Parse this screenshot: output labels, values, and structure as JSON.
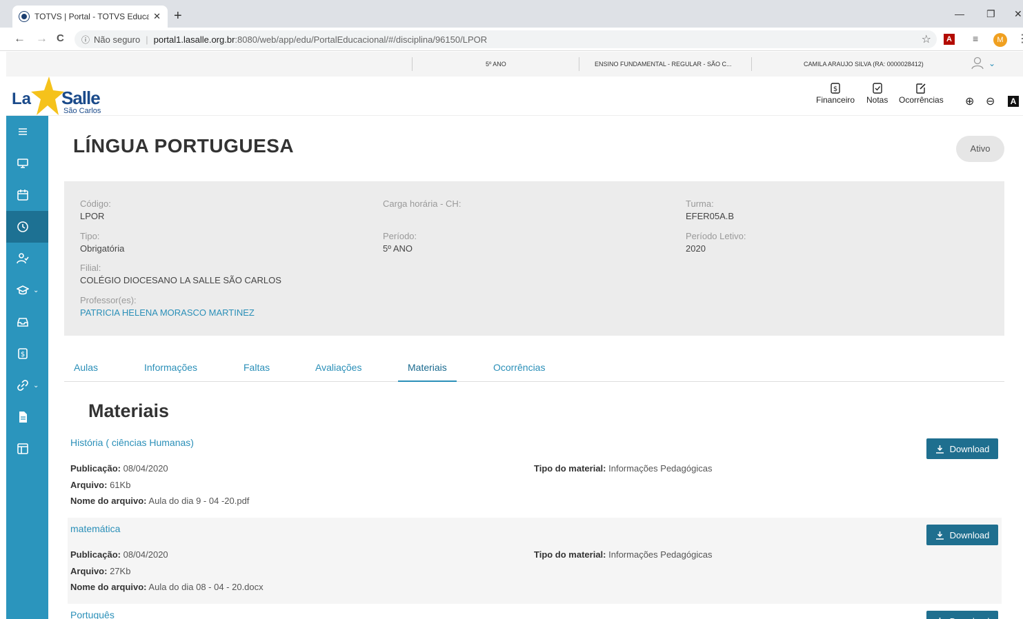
{
  "browser": {
    "tab_title": "TOTVS | Portal - TOTVS Educacio",
    "tab_close": "✕",
    "new_tab": "+",
    "minimize": "—",
    "maximize": "❐",
    "close": "✕",
    "back": "←",
    "forward": "→",
    "reload": "C",
    "info_icon": "ⓘ",
    "security_label": "Não seguro",
    "url_host": "portal1.lasalle.org.br",
    "url_path": ":8080/web/app/edu/PortalEducacional/#/disciplina/96150/LPOR",
    "star": "☆",
    "pdf_ext": "A",
    "list_ext": "≡",
    "profile_initial": "M",
    "kebab": "⋮"
  },
  "context_bar": {
    "grade": "5º ANO",
    "course": "ENSINO FUNDAMENTAL - REGULAR - SÃO C...",
    "student": "CAMILA ARAUJO SILVA (RA: 0000028412)",
    "chevron": "⌄"
  },
  "logo": {
    "la": "La",
    "salle": "Salle",
    "subtitle": "São Carlos"
  },
  "quick_access": [
    {
      "label": "Financeiro",
      "icon": "dollar-doc-icon"
    },
    {
      "label": "Notas",
      "icon": "check-doc-icon"
    },
    {
      "label": "Ocorrências",
      "icon": "edit-doc-icon"
    }
  ],
  "accessibility": {
    "zoom_in": "⊕",
    "zoom_out": "⊖",
    "contrast": "A"
  },
  "sidebar": {
    "items": [
      {
        "icon": "menu-icon"
      },
      {
        "icon": "monitor-icon"
      },
      {
        "icon": "calendar-icon"
      },
      {
        "icon": "clock-icon",
        "active": true
      },
      {
        "icon": "user-check-icon"
      },
      {
        "icon": "graduation-cap-icon",
        "chevron": "⌄"
      },
      {
        "icon": "inbox-icon"
      },
      {
        "icon": "dollar-icon"
      },
      {
        "icon": "link-icon",
        "chevron": "⌄"
      },
      {
        "icon": "document-icon"
      },
      {
        "icon": "layout-icon"
      }
    ]
  },
  "page": {
    "title": "LÍNGUA PORTUGUESA",
    "status": "Ativo"
  },
  "info": {
    "codigo_label": "Código:",
    "codigo_value": "LPOR",
    "carga_label": "Carga horária - CH:",
    "carga_value": "",
    "turma_label": "Turma:",
    "turma_value": "EFER05A.B",
    "tipo_label": "Tipo:",
    "tipo_value": "Obrigatória",
    "periodo_label": "Período:",
    "periodo_value": "5º ANO",
    "periodo_letivo_label": "Período Letivo:",
    "periodo_letivo_value": "2020",
    "filial_label": "Filial:",
    "filial_value": "COLÉGIO DIOCESANO LA SALLE SÃO CARLOS",
    "professor_label": "Professor(es):",
    "professor_value": "PATRICIA HELENA MORASCO MARTINEZ"
  },
  "tabs": [
    {
      "label": "Aulas"
    },
    {
      "label": "Informações"
    },
    {
      "label": "Faltas"
    },
    {
      "label": "Avaliações"
    },
    {
      "label": "Materiais",
      "active": true
    },
    {
      "label": "Ocorrências"
    }
  ],
  "materials": {
    "section_title": "Materiais",
    "labels": {
      "publicacao": "Publicação:",
      "arquivo": "Arquivo:",
      "nome_arquivo": "Nome do arquivo:",
      "tipo_material": "Tipo do material:",
      "download": "Download"
    },
    "items": [
      {
        "title": "História ( ciências Humanas)",
        "publicacao": "08/04/2020",
        "arquivo": "61Kb",
        "nome_arquivo": "Aula do dia 9 - 04 -20.pdf",
        "tipo_material": "Informações Pedagógicas"
      },
      {
        "title": "matemática",
        "publicacao": "08/04/2020",
        "arquivo": "27Kb",
        "nome_arquivo": "Aula do dia 08 - 04 - 20.docx",
        "tipo_material": "Informações Pedagógicas"
      },
      {
        "title": "Português"
      }
    ]
  }
}
